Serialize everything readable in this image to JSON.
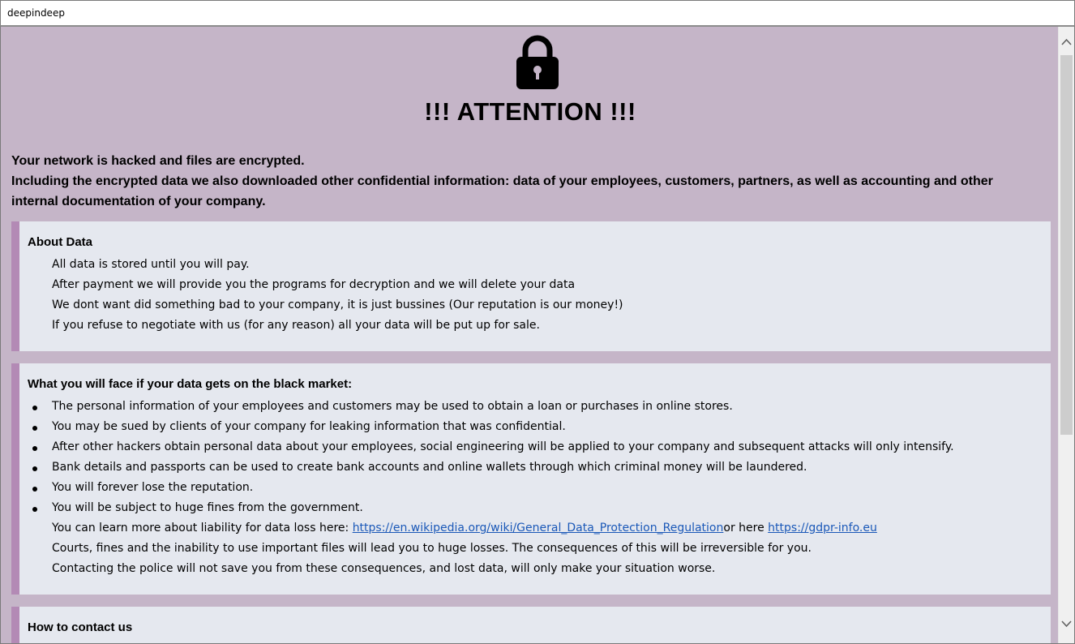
{
  "window": {
    "title": "deepindeep"
  },
  "header": {
    "lock_icon": "lock-icon",
    "headline": "!!! ATTENTION !!!"
  },
  "intro": {
    "line1": "Your network is hacked and files are encrypted.",
    "line2": "Including the encrypted data we also downloaded other confidential information: data of your employees, customers, partners, as well as accounting and other internal documentation of your company."
  },
  "about_data": {
    "title": "About Data",
    "lines": [
      "All data is stored until you will pay.",
      "After payment we will provide you the programs for decryption and we will delete your data",
      "We dont want did something bad to your company, it is just bussines (Our reputation is our money!)",
      "If you refuse to negotiate with us (for any reason) all your data will be put up for sale."
    ]
  },
  "black_market": {
    "title": "What you will face if your data gets on the black market:",
    "bullets": [
      "The personal information of your employees and customers may be used to obtain a loan or purchases in online stores.",
      "You may be sued by clients of your company for leaking information that was confidential.",
      "After other hackers obtain personal data about your employees, social engineering will be applied to your company and subsequent attacks will only intensify.",
      "Bank details and passports can be used to create bank accounts and online wallets through which criminal money will be laundered.",
      "You will forever lose the reputation.",
      "You will be subject to huge fines from the government."
    ],
    "liability_prefix": "You can learn more about liability for data loss here: ",
    "link1": "https://en.wikipedia.org/wiki/General_Data_Protection_Regulation",
    "link_mid": "or here ",
    "link2": "https://gdpr-info.eu",
    "courts": "Courts, fines and the inability to use important files will lead you to huge losses. The consequences of this will be irreversible for you.",
    "police": "Contacting the police will not save you from these consequences, and lost data, will only make your situation worse."
  },
  "contact": {
    "title": "How to contact us"
  },
  "colors": {
    "page_bg": "#c5b5c8",
    "panel_bg": "#e5e8ef",
    "panel_accent": "#b38ab5",
    "link": "#1a58b8"
  }
}
